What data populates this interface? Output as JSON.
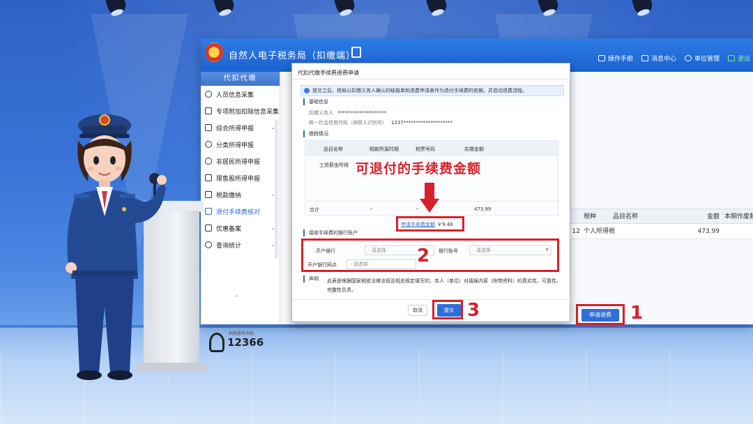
{
  "app": {
    "title": "自然人电子税务局（扣缴端）",
    "top_menu": [
      "操作手册",
      "消息中心",
      "单位管理",
      "退出"
    ]
  },
  "sidebar": {
    "header": "代扣代缴",
    "items": [
      {
        "label": "人员信息采集",
        "icon": "person-icon"
      },
      {
        "label": "专项附加扣除信息采集",
        "icon": "list-icon"
      },
      {
        "label": "综合所得申报",
        "icon": "layers-icon"
      },
      {
        "label": "分类所得申报",
        "icon": "clock-icon"
      },
      {
        "label": "非居民所得申报",
        "icon": "person-icon"
      },
      {
        "label": "限售股所得申报",
        "icon": "grid-icon"
      },
      {
        "label": "税款缴纳",
        "icon": "bar-chart-icon"
      },
      {
        "label": "退付手续费核对",
        "icon": "book-icon"
      },
      {
        "label": "优惠备案",
        "icon": "doc-icon"
      },
      {
        "label": "查询统计",
        "icon": "search-icon"
      }
    ],
    "hotline_small": "纳税服务热线",
    "hotline_number": "12366"
  },
  "main": {
    "table_headers": [
      "税种",
      "品目名称",
      "金额",
      "本期作废数"
    ],
    "row": {
      "left_cut": "12",
      "tax_type": "个人所得税",
      "item_name": "",
      "amount": "473.99",
      "void": ""
    },
    "apply_button": "申请退费"
  },
  "dialog": {
    "title": "代扣代缴手续费退费申请",
    "notice": "提交之后，税局以扣缴义务人确认的结报单和退费申请表作为退付手续费的依据，并启动退费流程。",
    "basic_info_label": "基础信息",
    "withholder_label": "扣缴义务人",
    "withholder_value": "********************",
    "credit_code_label": "统一社会信用代码（纳税人识别号）",
    "credit_code_value": "1237********************",
    "tax_section_label": "缴税情况",
    "tax_table_headers": [
      "品目名称",
      "税款所属时期",
      "税票号码",
      "实缴金额"
    ],
    "tax_row_item": "工资薪金所得",
    "total_label": "合计",
    "total_dash1": "--",
    "total_dash2": "--",
    "total_amount": "473.99",
    "fee_label": "申请手续费金额",
    "fee_value": "￥9.48",
    "bank_section_label": "接收手续费的银行账户",
    "bank_label": "开户银行",
    "bank_placeholder": "- 请选择 -",
    "account_label": "银行账号",
    "account_placeholder": "- 请选择 -",
    "branch_label": "开户银行网点",
    "branch_placeholder": "- 请选择 -",
    "declaration_label": "声明",
    "declaration_text": "此表是根据国家税收法律法规及相关规定填写的，本人（单位）对填报内容（附带资料）的真实性、可靠性、完整性负责。",
    "cancel": "取消",
    "submit": "提交"
  },
  "annotations": {
    "overlay_title": "可退付的手续费金额",
    "step1": "1",
    "step2": "2",
    "step3": "3"
  },
  "colors": {
    "accent_red": "#d8202a",
    "primary_blue": "#2e6fd8",
    "titlebar_blue": "#1c62d0"
  }
}
